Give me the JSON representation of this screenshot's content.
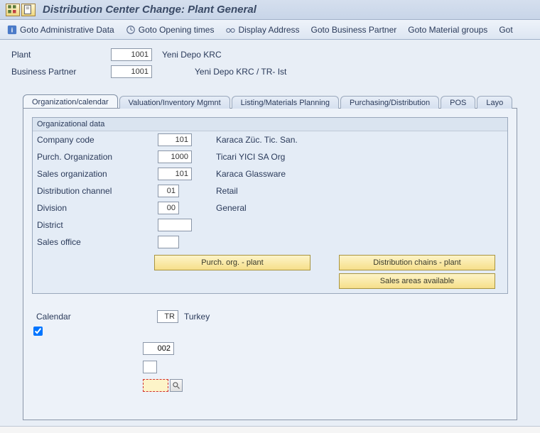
{
  "title": "Distribution Center Change: Plant General",
  "toolbar": {
    "goto_admin": "Goto Administrative Data",
    "goto_opening": "Goto Opening times",
    "display_address": "Display Address",
    "goto_bp": "Goto Business Partner",
    "goto_material": "Goto Material groups",
    "goto_more": "Got"
  },
  "header": {
    "plant_label": "Plant",
    "plant_value": "1001",
    "plant_desc": "Yeni Depo KRC",
    "bp_label": "Business Partner",
    "bp_value": "1001",
    "bp_desc": "Yeni Depo KRC / TR- Ist"
  },
  "tabs": {
    "t1": "Organization/calendar",
    "t2": "Valuation/Inventory Mgmnt",
    "t3": "Listing/Materials Planning",
    "t4": "Purchasing/Distribution",
    "t5": "POS",
    "t6": "Layo"
  },
  "org": {
    "title": "Organizational data",
    "company_code_label": "Company code",
    "company_code_value": "101",
    "company_code_desc": "Karaca Züc. Tic. San.",
    "purch_org_label": "Purch. Organization",
    "purch_org_value": "1000",
    "purch_org_desc": "Ticari YICI SA Org",
    "sales_org_label": "Sales organization",
    "sales_org_value": "101",
    "sales_org_desc": "Karaca Glassware",
    "dist_channel_label": "Distribution channel",
    "dist_channel_value": "01",
    "dist_channel_desc": "Retail",
    "division_label": "Division",
    "division_value": "00",
    "division_desc": "General",
    "district_label": "District",
    "district_value": "",
    "sales_office_label": "Sales office",
    "sales_office_value": "",
    "btn_purch_org": "Purch. org. - plant",
    "btn_dist_chains": "Distribution chains - plant",
    "btn_sales_areas": "Sales areas available"
  },
  "calendar": {
    "label": "Calendar",
    "value": "TR",
    "desc": "Turkey"
  },
  "small": {
    "v1": "002",
    "v2": "",
    "v3": ""
  }
}
